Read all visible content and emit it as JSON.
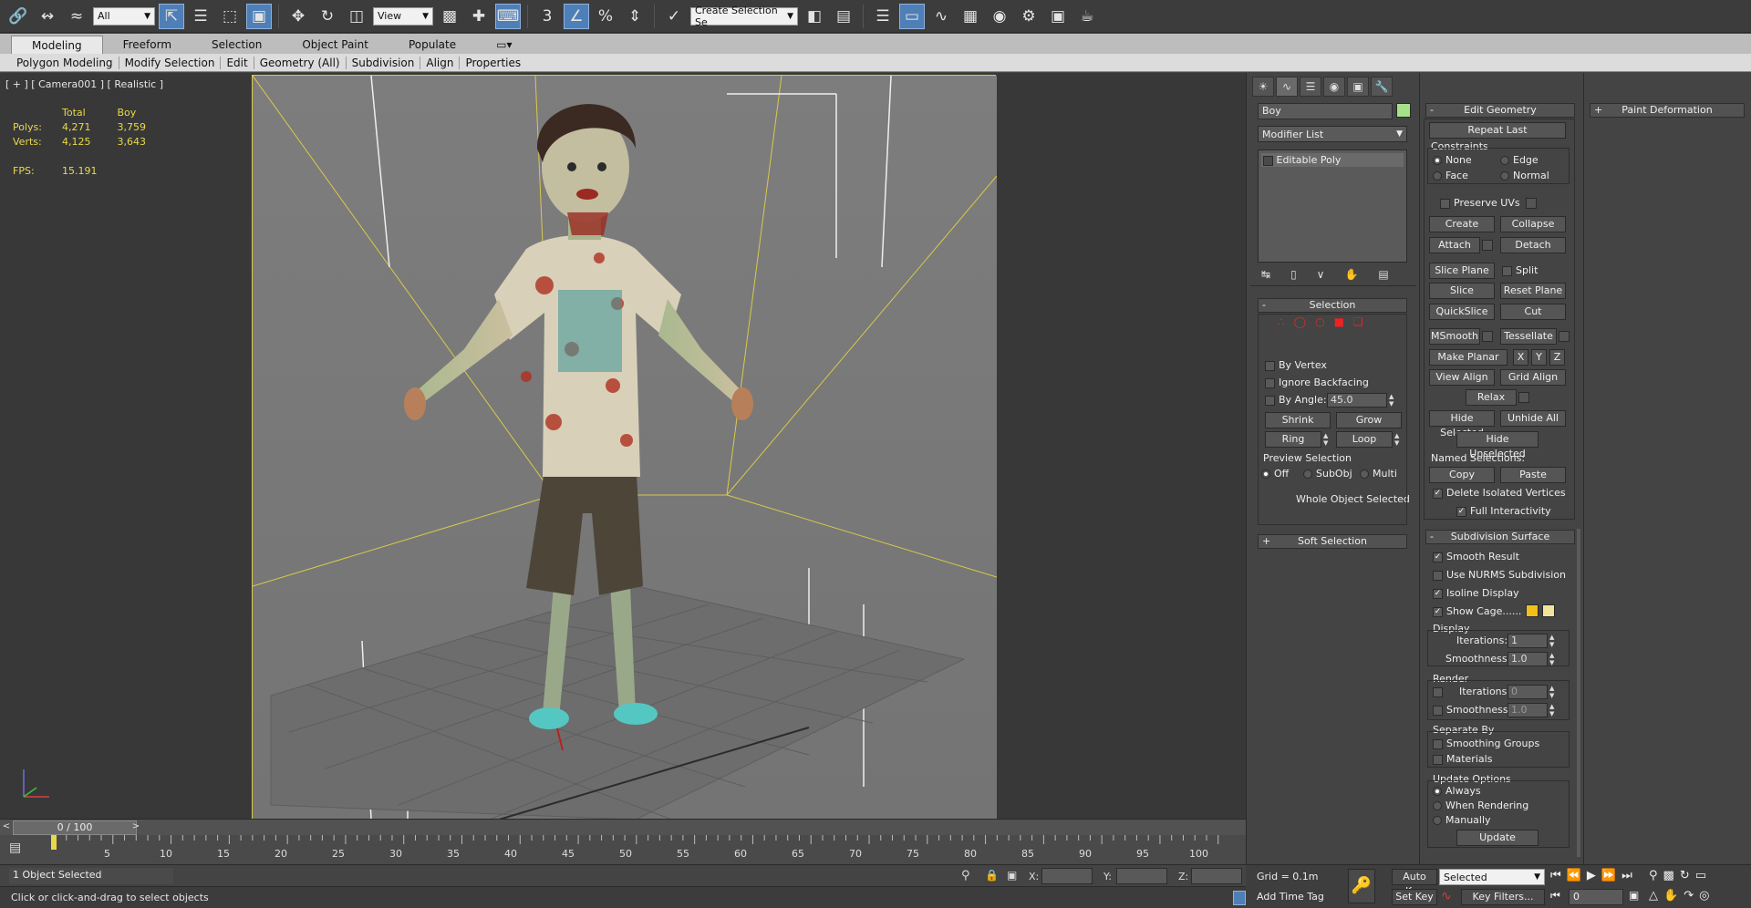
{
  "toolbar": {
    "selection_filter": "All",
    "reference_coord": "View",
    "snaps_label": "3",
    "angle_snap_label": "",
    "percent_snap_label": "%",
    "named_selection_placeholder": "Create Selection Se"
  },
  "ribbon": {
    "tabs": [
      "Modeling",
      "Freeform",
      "Selection",
      "Object Paint",
      "Populate"
    ],
    "sub_items": [
      "Polygon Modeling",
      "Modify Selection",
      "Edit",
      "Geometry (All)",
      "Subdivision",
      "Align",
      "Properties"
    ]
  },
  "viewport": {
    "label": "[ + ] [ Camera001 ] [ Realistic ]",
    "stats_header_total": "Total",
    "stats_header_object": "Boy",
    "polys_label": "Polys:",
    "polys_total": "4,271",
    "polys_object": "3,759",
    "verts_label": "Verts:",
    "verts_total": "4,125",
    "verts_object": "3,643",
    "fps_label": "FPS:",
    "fps_value": "15.191"
  },
  "timeline": {
    "frame_display": "0 / 100",
    "ticks": [
      "5",
      "10",
      "15",
      "20",
      "25",
      "30",
      "35",
      "40",
      "45",
      "50",
      "55",
      "60",
      "65",
      "70",
      "75",
      "80",
      "85",
      "90",
      "95",
      "100"
    ]
  },
  "status": {
    "selection_text": "1 Object Selected",
    "prompt_text": "Click or click-and-drag to select objects",
    "x_label": "X:",
    "y_label": "Y:",
    "z_label": "Z:",
    "grid_text": "Grid = 0.1m",
    "add_time_tag": "Add Time Tag"
  },
  "anim": {
    "auto_key": "Auto Key",
    "set_key": "Set Key",
    "selected": "Selected",
    "key_filters": "Key Filters...",
    "frame_value": "0"
  },
  "command_panel": {
    "object_name": "Boy",
    "object_color": "#a6e28a",
    "modifier_list": "Modifier List",
    "stack_item": "Editable Poly",
    "selection_title": "Selection",
    "by_vertex": "By Vertex",
    "ignore_backfacing": "Ignore Backfacing",
    "by_angle": "By Angle:",
    "by_angle_value": "45.0",
    "shrink": "Shrink",
    "grow": "Grow",
    "ring": "Ring",
    "loop": "Loop",
    "preview_selection": "Preview Selection",
    "preview_off": "Off",
    "preview_subobj": "SubObj",
    "preview_multi": "Multi",
    "whole_object": "Whole Object Selected",
    "soft_selection": "Soft Selection"
  },
  "edit_geometry": {
    "title": "Edit Geometry",
    "repeat_last": "Repeat Last",
    "constraints": "Constraints",
    "c_none": "None",
    "c_edge": "Edge",
    "c_face": "Face",
    "c_normal": "Normal",
    "preserve_uvs": "Preserve UVs",
    "create": "Create",
    "collapse": "Collapse",
    "attach": "Attach",
    "detach": "Detach",
    "slice_plane": "Slice Plane",
    "split": "Split",
    "slice": "Slice",
    "reset_plane": "Reset Plane",
    "quickslice": "QuickSlice",
    "cut": "Cut",
    "msmooth": "MSmooth",
    "tessellate": "Tessellate",
    "make_planar": "Make Planar",
    "x": "X",
    "y": "Y",
    "z": "Z",
    "view_align": "View Align",
    "grid_align": "Grid Align",
    "relax": "Relax",
    "hide_selected": "Hide Selected",
    "unhide_all": "Unhide All",
    "hide_unselected": "Hide Unselected",
    "named_selections": "Named Selections:",
    "copy": "Copy",
    "paste": "Paste",
    "delete_isolated": "Delete Isolated Vertices",
    "full_interactivity": "Full Interactivity"
  },
  "subdivision": {
    "title": "Subdivision Surface",
    "smooth_result": "Smooth Result",
    "use_nurms": "Use NURMS Subdivision",
    "isoline": "Isoline Display",
    "show_cage": "Show Cage......",
    "cage_color_1": "#f2c01a",
    "cage_color_2": "#efe59a",
    "display": "Display",
    "iterations": "Iterations:",
    "iterations_value": "1",
    "smoothness": "Smoothness:",
    "smoothness_value": "1.0",
    "render": "Render",
    "r_iterations": "Iterations:",
    "r_iterations_value": "0",
    "r_smoothness": "Smoothness:",
    "r_smoothness_value": "1.0",
    "separate_by": "Separate By",
    "smoothing_groups": "Smoothing Groups",
    "materials": "Materials",
    "update_options": "Update Options",
    "always": "Always",
    "when_rendering": "When Rendering",
    "manually": "Manually",
    "update": "Update"
  },
  "paint_panel": {
    "title": "Paint Deformation"
  }
}
